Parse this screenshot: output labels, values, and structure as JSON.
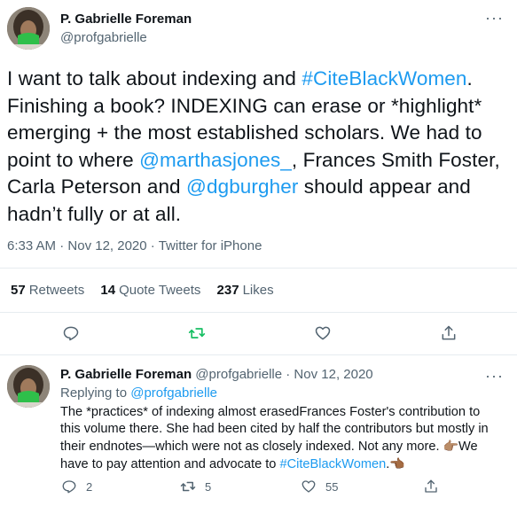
{
  "tweet": {
    "author_name": "P. Gabrielle Foreman",
    "author_handle": "@profgabrielle",
    "text": {
      "p1": "I want to talk about indexing and ",
      "hashtag": "#CiteBlackWomen",
      "p2": ". Finishing a book? INDEXING can erase or *highlight* emerging + the most established scholars. We had to point to where ",
      "mention1": "@marthasjones_",
      "p3": ", Frances Smith Foster, Carla Peterson and ",
      "mention2": "@dgburgher",
      "p4": " should appear and hadn’t fully or at all."
    },
    "time": "6:33 AM",
    "date": "Nov 12, 2020",
    "source": "Twitter for iPhone",
    "sep": "·",
    "retweets_count": "57",
    "retweets_label": "Retweets",
    "quotes_count": "14",
    "quotes_label": "Quote Tweets",
    "likes_count": "237",
    "likes_label": "Likes"
  },
  "reply": {
    "author_name": "P. Gabrielle Foreman",
    "author_handle": "@profgabrielle",
    "sep": "·",
    "date": "Nov 12, 2020",
    "replying_prefix": "Replying to ",
    "replying_handle": "@profgabrielle",
    "text": {
      "p1": "The *practices* of indexing almost erasedFrances Foster's contribution to this volume there. She had been cited by half the contributors but mostly in their endnotes—which were not as closely indexed. Not any more. ",
      "emoji1": "👉🏽",
      "p2": "We have to pay attention and advocate to ",
      "hashtag": "#CiteBlackWomen",
      "p3": ".",
      "emoji2": "👈🏾"
    },
    "reply_count": "2",
    "retweet_count": "5",
    "like_count": "55"
  },
  "colors": {
    "accent": "#1d9bf0",
    "retweet_green": "#17bf63",
    "muted": "#536471"
  },
  "icons": [
    "reply-icon",
    "retweet-icon",
    "like-icon",
    "share-icon",
    "more-icon"
  ]
}
